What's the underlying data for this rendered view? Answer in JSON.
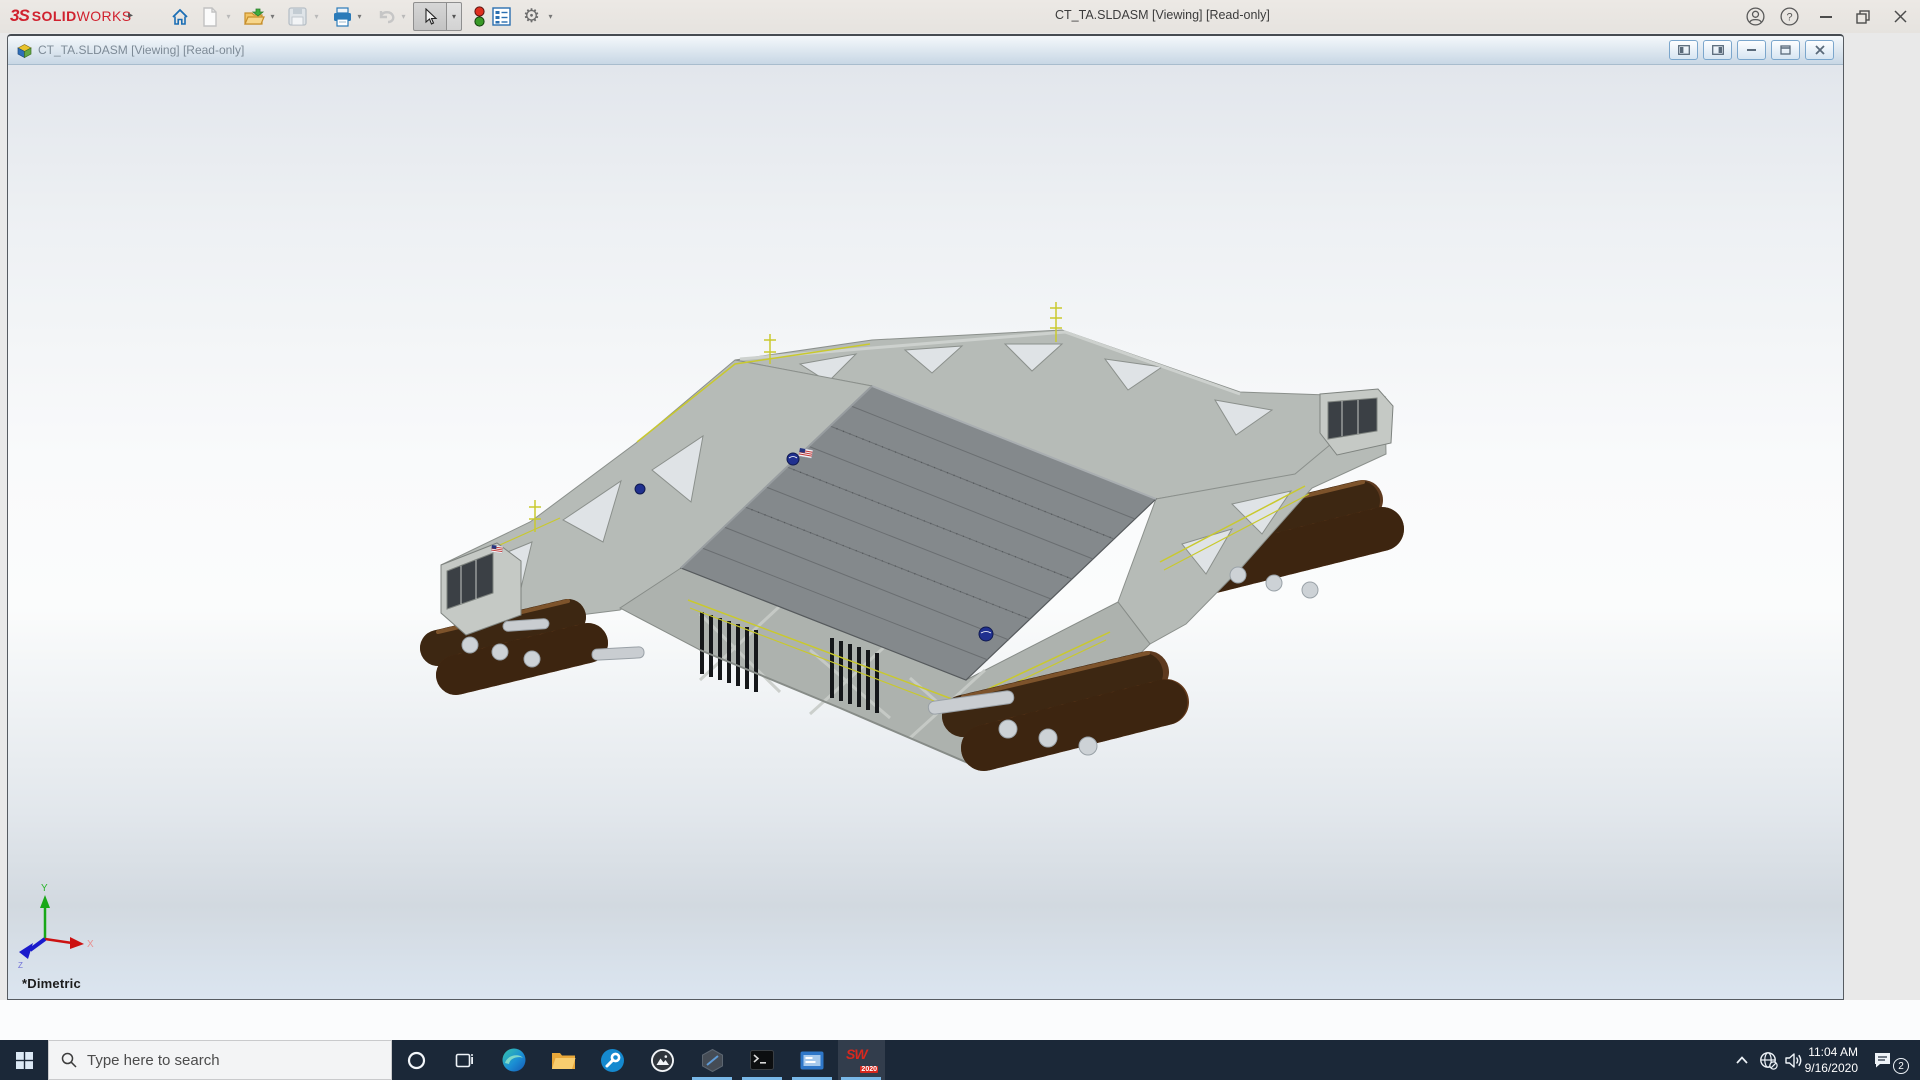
{
  "app": {
    "brand": {
      "mark": "3S",
      "name_bold": "SOLID",
      "name_light": "WORKS"
    },
    "title": "CT_TA.SLDASM [Viewing] [Read-only]",
    "toolbar": {
      "buttons": [
        "home",
        "new",
        "open",
        "save",
        "print",
        "undo",
        "select",
        "display-states",
        "bill-of-materials",
        "options"
      ],
      "disabled": [
        "new",
        "save",
        "undo"
      ],
      "active": "select"
    },
    "window_controls": [
      "account",
      "help",
      "minimize",
      "restore",
      "close"
    ],
    "help_glyph": "?"
  },
  "document": {
    "title": "CT_TA.SLDASM [Viewing] [Read-only]",
    "window_controls": [
      "tile-left",
      "tile-right",
      "minimize",
      "restore",
      "close"
    ],
    "view_orientation": "*Dimetric",
    "triad": {
      "x": "X",
      "y": "Y",
      "z": "Z"
    }
  },
  "taskbar": {
    "search_placeholder": "Type here to search",
    "pinned_apps": [
      "edge",
      "file-explorer",
      "tool-circle",
      "photos",
      "hexagon-app",
      "command-prompt",
      "app-window",
      "solidworks-2020"
    ],
    "running_apps": [
      "hexagon-app",
      "command-prompt",
      "app-window",
      "solidworks-2020"
    ],
    "solidworks_letters": "SW",
    "solidworks_year_badge": "2020",
    "tray": {
      "time": "11:04 AM",
      "date": "9/16/2020",
      "notifications": "2"
    }
  },
  "colors": {
    "brand_red": "#d0212e",
    "taskbar": "#1b2838",
    "running_indicator": "#79b8e8",
    "track_brown": "#5e3a1f",
    "structure_gray": "#b6bbb7",
    "deck_gray": "#84898c",
    "nasa_blue": "#20308f",
    "rail_yellow": "#c9c92e"
  }
}
